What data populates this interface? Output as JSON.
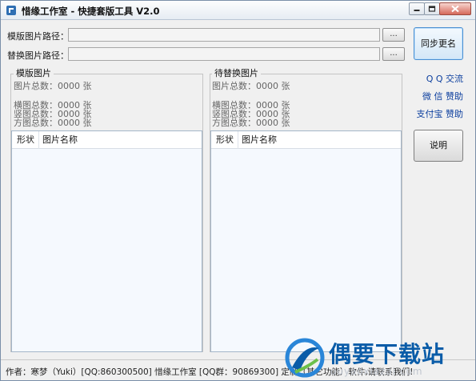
{
  "window": {
    "title": "惜缘工作室 - 快捷套版工具 V2.0"
  },
  "paths": {
    "template_label": "模版图片路径：",
    "template_value": "",
    "replace_label": "替换图片路径：",
    "replace_value": "",
    "browse_label": "..."
  },
  "side": {
    "rename_button": "同步更名",
    "qq_link": "Q Q 交流",
    "wechat_link": "微 信 赞助",
    "alipay_link": "支付宝 赞助",
    "help_button": "说明"
  },
  "template_group": {
    "title": "模版图片",
    "total": "图片总数：0000 张",
    "horizontal": "横图总数：0000 张",
    "vertical": "竖图总数：0000 张",
    "square": "方图总数：0000 张",
    "col_shape": "形状",
    "col_name": "图片名称"
  },
  "replace_group": {
    "title": "待替换图片",
    "total": "图片总数：0000 张",
    "horizontal": "横图总数：0000 张",
    "vertical": "竖图总数：0000 张",
    "square": "方图总数：0000 张",
    "col_shape": "形状",
    "col_name": "图片名称"
  },
  "status": {
    "text": "作者：寒梦（Yuki）[QQ:860300500]  惜缘工作室 [QQ群：90869300]  定制（其它功能）软件,请联系我们!"
  },
  "watermark": {
    "brand": "偶要下载站",
    "url": "ouyaoxiazai.com"
  },
  "colors": {
    "accent": "#0b3e9e",
    "window_bg": "#f0f0f0",
    "list_bg": "#f5f9fe",
    "watermark": "#0a5ca8"
  },
  "icons": [
    "app-icon",
    "minimize-icon",
    "maximize-icon",
    "close-icon",
    "watermark-logo-icon"
  ]
}
